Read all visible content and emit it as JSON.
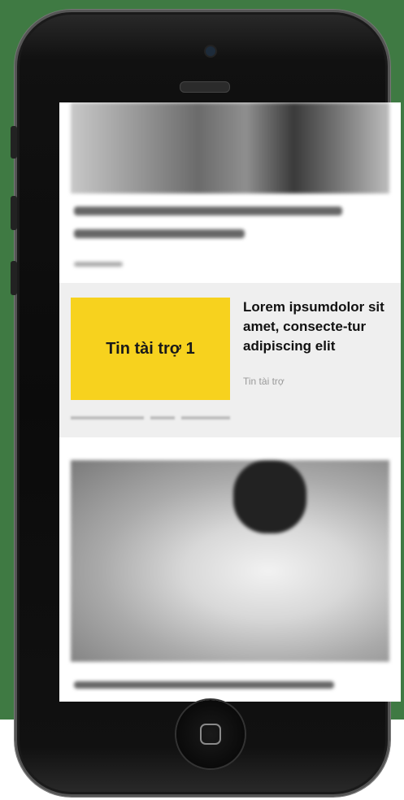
{
  "ad": {
    "sponsor_box": "Tin tài trợ 1",
    "title": "Lorem ipsumdolor sit amet, consecte-tur adipiscing elit",
    "label": "Tin tài trợ",
    "colors": {
      "box": "#f7d21e",
      "block_bg": "#efefef"
    }
  },
  "background_color": "#3f7a43",
  "icons": [
    "camera-icon",
    "speaker-icon",
    "home-button-icon"
  ]
}
